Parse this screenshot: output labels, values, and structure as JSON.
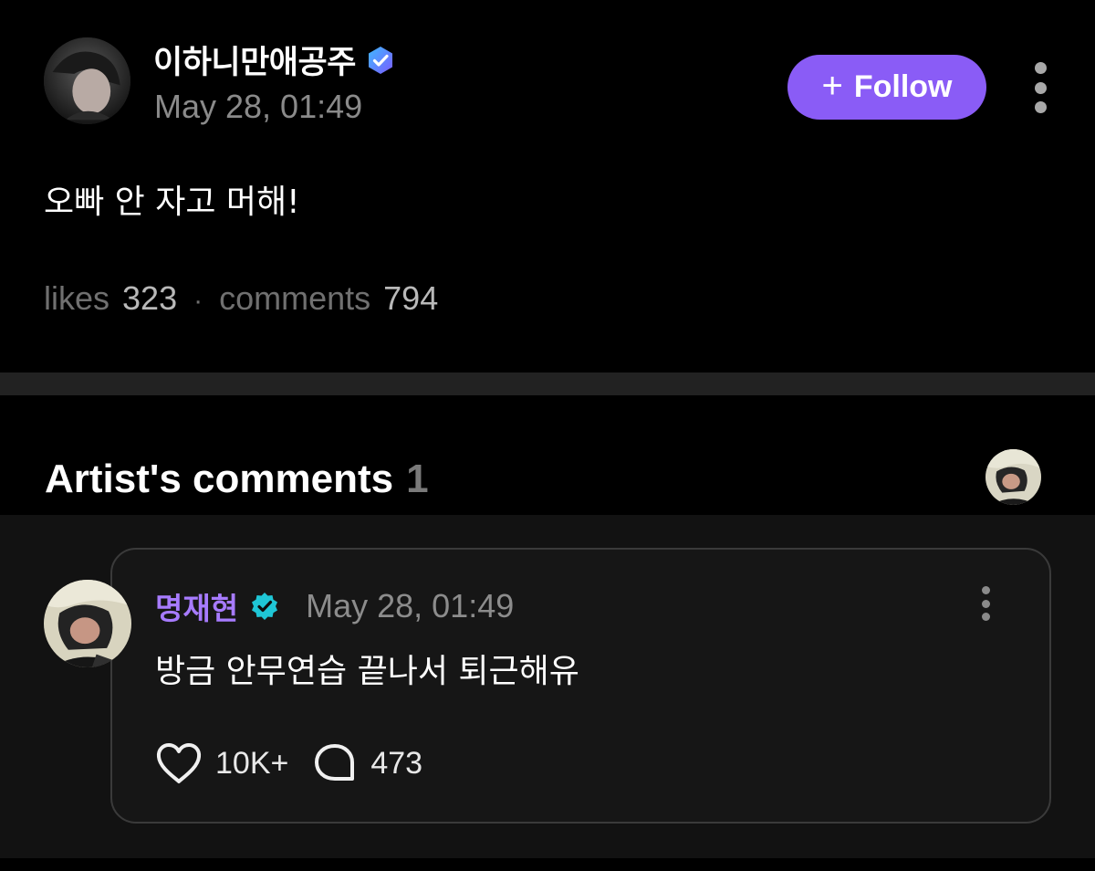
{
  "post": {
    "author_name": "이하니만애공주",
    "author_badge_icon": "verified-hexagon-icon",
    "timestamp": "May 28, 01:49",
    "follow_button": {
      "icon": "plus-icon",
      "label": "Follow"
    },
    "body": "오빠 안 자고 머해!",
    "stats": {
      "likes_label": "likes",
      "likes_count": "323",
      "separator": "·",
      "comments_label": "comments",
      "comments_count": "794"
    }
  },
  "artist_comments": {
    "title": "Artist's comments",
    "count": "1",
    "comments": [
      {
        "author": "명재현",
        "badge_icon": "verified-check-icon",
        "timestamp": "May 28, 01:49",
        "text": "방금 안무연습 끝나서 퇴근해유",
        "likes": "10K+",
        "replies": "473"
      }
    ]
  },
  "colors": {
    "background": "#000000",
    "accent_purple": "#8a5cf6",
    "artist_name": "#a77bff",
    "verified_teal": "#1fc6d6",
    "verified_blue": "#5b7cff",
    "muted_text": "#8a8a8a"
  }
}
